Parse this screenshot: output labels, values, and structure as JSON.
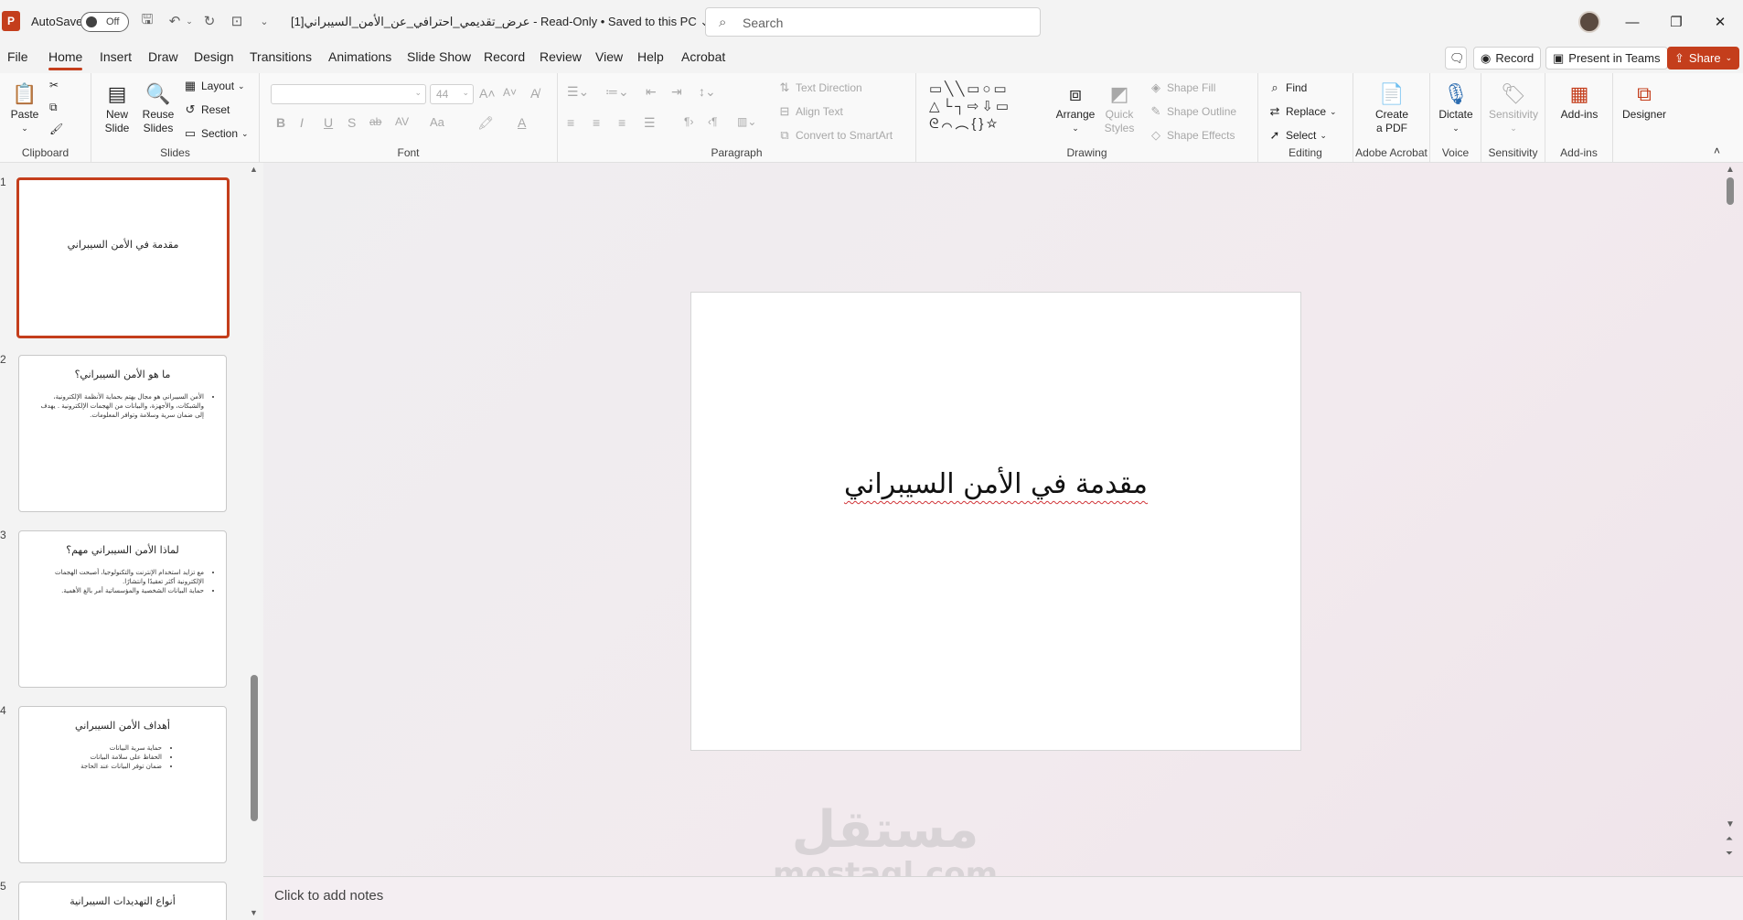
{
  "titlebar": {
    "app_letter": "P",
    "autosave_label": "AutoSave",
    "autosave_state": "Off",
    "doc_title": "عرض_تقديمي_احترافي_عن_الأمن_السيبراني[1]  -  Read-Only  •  Saved to this PC ⌄",
    "search_placeholder": "Search"
  },
  "menu": {
    "tabs": [
      "File",
      "Home",
      "Insert",
      "Draw",
      "Design",
      "Transitions",
      "Animations",
      "Slide Show",
      "Record",
      "Review",
      "View",
      "Help",
      "Acrobat"
    ],
    "active_tab": "Home",
    "record_label": "Record",
    "teams_label": "Present in Teams",
    "share_label": "Share"
  },
  "ribbon": {
    "clipboard": {
      "label": "Clipboard",
      "paste": "Paste"
    },
    "slides": {
      "label": "Slides",
      "new_slide_1": "New",
      "new_slide_2": "Slide",
      "reuse_1": "Reuse",
      "reuse_2": "Slides",
      "layout": "Layout",
      "reset": "Reset",
      "section": "Section"
    },
    "font": {
      "label": "Font",
      "size": "44",
      "buttons": [
        "B",
        "I",
        "U",
        "S",
        "ab",
        "AV",
        "Aa",
        "A"
      ]
    },
    "paragraph": {
      "label": "Paragraph",
      "text_direction": "Text Direction",
      "align_text": "Align Text",
      "smartart": "Convert to SmartArt"
    },
    "drawing": {
      "label": "Drawing",
      "arrange": "Arrange",
      "quick_1": "Quick",
      "quick_2": "Styles",
      "shape_fill": "Shape Fill",
      "shape_outline": "Shape Outline",
      "shape_effects": "Shape Effects"
    },
    "editing": {
      "label": "Editing",
      "find": "Find",
      "replace": "Replace",
      "select": "Select"
    },
    "acrobat": {
      "label": "Adobe Acrobat",
      "create_1": "Create",
      "create_2": "a PDF"
    },
    "voice": {
      "label": "Voice",
      "dictate": "Dictate"
    },
    "sensitivity": {
      "label": "Sensitivity",
      "button": "Sensitivity"
    },
    "addins": {
      "label": "Add-ins",
      "button": "Add-ins"
    },
    "designer": {
      "button": "Designer"
    }
  },
  "thumbnails": [
    {
      "num": "1",
      "title": "مقدمة في الأمن السيبراني",
      "bullets": []
    },
    {
      "num": "2",
      "title": "ما هو الأمن السيبراني؟",
      "bullets": [
        "الأمن السيبراني هو مجال يهتم بحماية الأنظمة الإلكترونية، والشبكات، والأجهزة، والبيانات من الهجمات الإلكترونية . يهدف إلى ضمان سرية وسلامة وتوافر المعلومات."
      ]
    },
    {
      "num": "3",
      "title": "لماذا الأمن السيبراني مهم؟",
      "bullets": [
        "مع تزايد استخدام الإنترنت والتكنولوجيا، أصبحت الهجمات الإلكترونية أكثر تعقيدًا وانتشارًا.",
        "حماية البيانات الشخصية والمؤسساتية أمر بالغ الأهمية."
      ]
    },
    {
      "num": "4",
      "title": "أهداف الأمن السيبراني",
      "bullets": [
        "حماية سرية البيانات",
        "الحفاظ على سلامة البيانات",
        "ضمان توفر البيانات عند الحاجة"
      ]
    },
    {
      "num": "5",
      "title": "أنواع التهديدات السيبرانية",
      "bullets": []
    }
  ],
  "slide": {
    "title": "مقدمة في الأمن السيبراني"
  },
  "watermark": {
    "line1": "مستقل",
    "line2": "mostaql.com"
  },
  "notes": {
    "placeholder": "Click to add notes"
  },
  "colors": {
    "accent": "#c43e1c"
  }
}
